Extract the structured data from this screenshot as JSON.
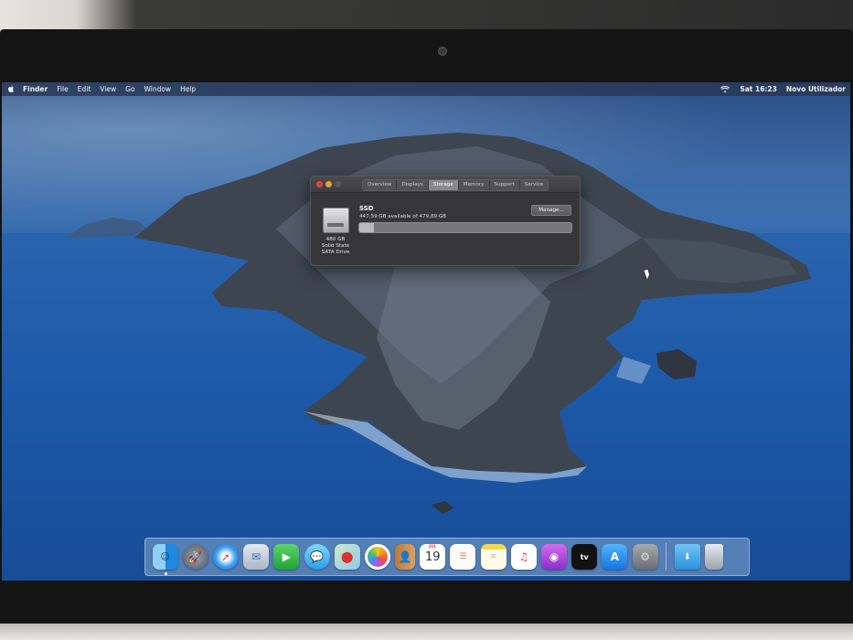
{
  "menu_bar": {
    "app_name": "Finder",
    "items": [
      "File",
      "Edit",
      "View",
      "Go",
      "Window",
      "Help"
    ],
    "clock": "Sat 16:23",
    "user": "Novo Utilizador"
  },
  "about_window": {
    "tabs": [
      "Overview",
      "Displays",
      "Storage",
      "Memory",
      "Support",
      "Service"
    ],
    "active_tab": "Storage",
    "disk_name": "SSD",
    "available_text": "447,59 GB available of 479,89 GB",
    "manage_label": "Manage...",
    "disk_caption_line1": "480 GB",
    "disk_caption_line2": "Solid State",
    "disk_caption_line3": "SATA Drive",
    "used_fraction": 0.07
  },
  "dock": {
    "calendar_month": "JUL",
    "calendar_day": "19",
    "icons": [
      "finder-icon",
      "launchpad-icon",
      "safari-icon",
      "mail-icon",
      "facetime-icon",
      "messages-icon",
      "maps-icon",
      "photos-icon",
      "contacts-icon",
      "calendar-icon",
      "reminders-icon",
      "notes-icon",
      "music-icon",
      "podcasts-icon",
      "tv-icon",
      "app-store-icon",
      "system-preferences-icon",
      "downloads-folder-icon",
      "trash-icon"
    ]
  }
}
